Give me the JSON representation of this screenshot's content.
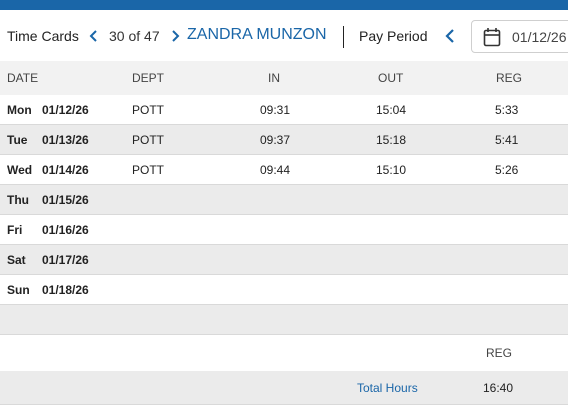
{
  "header": {
    "title": "Time Cards",
    "record_position": "30 of 47",
    "employee_name": "ZANDRA MUNZON",
    "period_label": "Pay Period",
    "period_start_date": "01/12/26"
  },
  "table": {
    "columns": [
      "DATE",
      "DEPT",
      "IN",
      "OUT",
      "REG"
    ],
    "rows": [
      {
        "day": "Mon",
        "date": "01/12/26",
        "dept": "POTT",
        "in": "09:31",
        "out": "15:04",
        "reg": "5:33"
      },
      {
        "day": "Tue",
        "date": "01/13/26",
        "dept": "POTT",
        "in": "09:37",
        "out": "15:18",
        "reg": "5:41"
      },
      {
        "day": "Wed",
        "date": "01/14/26",
        "dept": "POTT",
        "in": "09:44",
        "out": "15:10",
        "reg": "5:26"
      },
      {
        "day": "Thu",
        "date": "01/15/26",
        "dept": "",
        "in": "",
        "out": "",
        "reg": ""
      },
      {
        "day": "Fri",
        "date": "01/16/26",
        "dept": "",
        "in": "",
        "out": "",
        "reg": ""
      },
      {
        "day": "Sat",
        "date": "01/17/26",
        "dept": "",
        "in": "",
        "out": "",
        "reg": ""
      },
      {
        "day": "Sun",
        "date": "01/18/26",
        "dept": "",
        "in": "",
        "out": "",
        "reg": ""
      }
    ]
  },
  "summary": {
    "column": "REG",
    "label": "Total Hours",
    "value": "16:40"
  },
  "icons": {
    "prev_record": "chevron-left-icon",
    "next_record": "chevron-right-icon",
    "prev_period": "chevron-left-icon",
    "calendar": "calendar-icon"
  },
  "colors": {
    "accent": "#1a66a8",
    "row_alt": "#ebebeb",
    "header_bg": "#f2f2f2"
  }
}
